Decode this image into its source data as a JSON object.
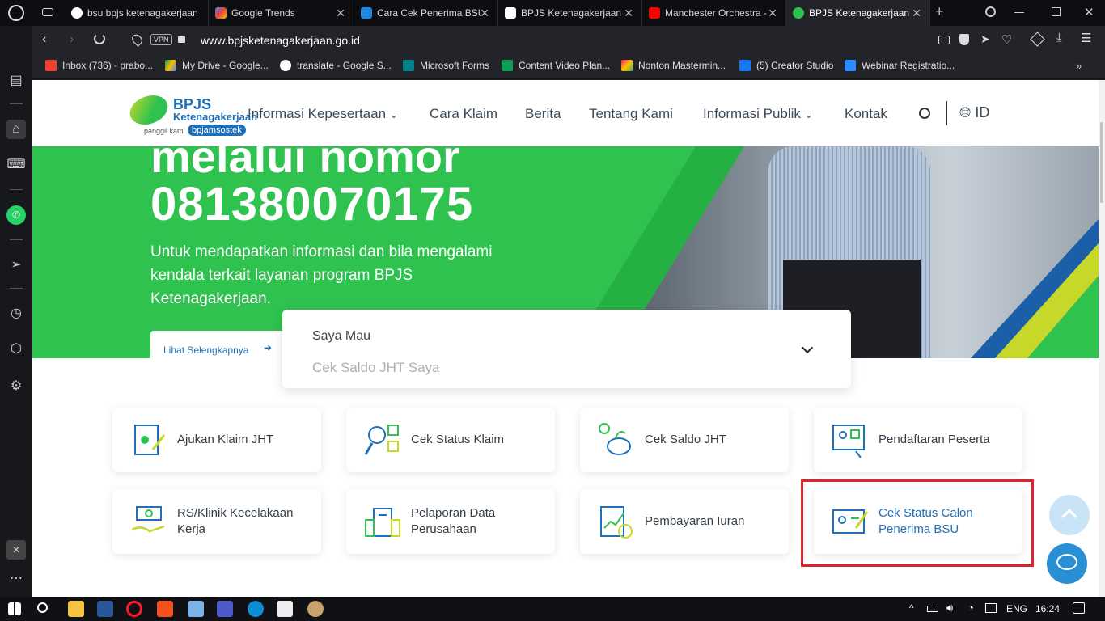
{
  "browser": {
    "tabs": [
      {
        "label": "bsu bpjs ketenagakerjaan",
        "favicon_color": "#4285f4",
        "active": false
      },
      {
        "label": "Google Trends",
        "favicon_color": "#e8453c",
        "active": false
      },
      {
        "label": "Cara Cek Penerima BSU",
        "favicon_color": "#1e88e5",
        "active": false
      },
      {
        "label": "BPJS Ketenagakerjaan",
        "favicon_color": "#ffffff",
        "active": false
      },
      {
        "label": "Manchester Orchestra -",
        "favicon_color": "#ff0000",
        "active": false
      },
      {
        "label": "BPJS Ketenagakerjaan",
        "favicon_color": "#2fc24f",
        "active": true
      }
    ],
    "url": "www.bpjsketenagakerjaan.go.id",
    "vpn_label": "VPN",
    "bookmarks": [
      {
        "label": "Inbox (736) - prabo...",
        "icon_color": "#ea4335"
      },
      {
        "label": "My Drive - Google...",
        "icon_color": "#fbbc04"
      },
      {
        "label": "translate - Google S...",
        "icon_color": "#ffffff"
      },
      {
        "label": "Microsoft Forms",
        "icon_color": "#038387"
      },
      {
        "label": "Content Video Plan...",
        "icon_color": "#0f9d58"
      },
      {
        "label": "Nonton Mastermin...",
        "icon_color": "#e91e63"
      },
      {
        "label": "(5) Creator Studio",
        "icon_color": "#1877f2"
      },
      {
        "label": "Webinar Registratio...",
        "icon_color": "#2d8cff"
      }
    ]
  },
  "site": {
    "logo_title": "BPJS",
    "logo_sub": "Ketenagakerjaan",
    "logo_tag1": "panggil kami",
    "logo_tag2": "bpjamsostek",
    "nav": [
      "Informasi Kepesertaan",
      "Cara Klaim",
      "Berita",
      "Tentang Kami",
      "Informasi Publik",
      "Kontak"
    ],
    "lang": "ID",
    "hero": {
      "line1": "melalui nomor",
      "phone": "081380070175",
      "body1": "Untuk mendapatkan informasi dan bila mengalami",
      "body2": "kendala terkait layanan program BPJS",
      "body3": "Ketenagakerjaan.",
      "more": "Lihat Selengkapnya"
    },
    "saya_mau": {
      "label": "Saya Mau",
      "placeholder": "Cek Saldo JHT Saya"
    },
    "services": [
      {
        "label": "Ajukan Klaim JHT",
        "highlighted": false
      },
      {
        "label": "Cek Status Klaim",
        "highlighted": false
      },
      {
        "label": "Cek Saldo JHT",
        "highlighted": false
      },
      {
        "label": "Pendaftaran Peserta",
        "highlighted": false
      },
      {
        "label": "RS/Klinik Kecelakaan Kerja",
        "highlighted": false
      },
      {
        "label": "Pelaporan Data Perusahaan",
        "highlighted": false
      },
      {
        "label": "Pembayaran Iuran",
        "highlighted": false
      },
      {
        "label": "Cek Status Calon Penerima BSU",
        "highlighted": true
      }
    ]
  },
  "taskbar": {
    "lang": "ENG",
    "time": "16:24"
  },
  "colors": {
    "brand_green": "#2fc24f",
    "brand_blue": "#1e6fb8",
    "highlight_red": "#e0232b",
    "chat_blue": "#2b8fd6"
  }
}
